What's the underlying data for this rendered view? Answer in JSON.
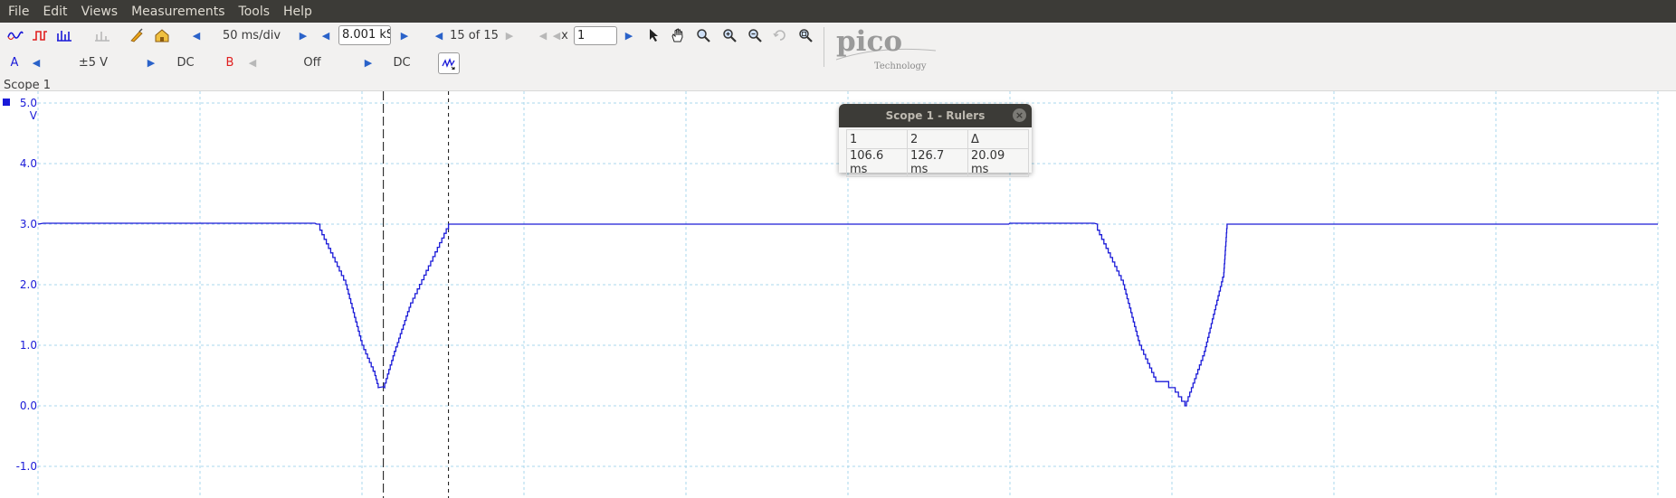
{
  "menu": [
    "File",
    "Edit",
    "Views",
    "Measurements",
    "Tools",
    "Help"
  ],
  "toolbar": {
    "timebase": "50 ms/div",
    "samples": "8.001 kS",
    "buffer": "15 of 15",
    "zoom_label": "x",
    "zoom_value": "1",
    "tool_icons": [
      "pointer-icon",
      "hand-icon",
      "zoom-area-icon",
      "zoom-in-icon",
      "zoom-out-icon",
      "undo-zoom-icon",
      "zoom-fit-icon"
    ]
  },
  "channels": {
    "a": {
      "name": "A",
      "range": "±5 V",
      "coupling": "DC",
      "color": "#1a1ad8"
    },
    "b": {
      "name": "B",
      "range": "Off",
      "coupling": "DC",
      "color": "#e02020"
    }
  },
  "logo": {
    "brand": "pico",
    "sub": "Technology"
  },
  "scope": {
    "title": "Scope 1",
    "y_unit": "V",
    "y_ticks": [
      "5.0",
      "4.0",
      "3.0",
      "2.0",
      "1.0",
      "0.0",
      "-1.0"
    ]
  },
  "rulers": {
    "title": "Scope 1 - Rulers",
    "headers": [
      "1",
      "2",
      "Δ"
    ],
    "values": [
      "106.6 ms",
      "126.7 ms",
      "20.09 ms"
    ]
  },
  "chart_data": {
    "type": "line",
    "xlabel": "",
    "ylabel": "V",
    "ylim": [
      -1.4,
      5.0
    ],
    "x_unit": "ms",
    "xlim": [
      0,
      500
    ],
    "grid": true,
    "series": [
      {
        "color": "#1a1ad8",
        "x": [
          0,
          86,
          87,
          95,
          100,
          104,
          105,
          106.6,
          110,
          115,
          126.7,
          127,
          300,
          326,
          327,
          335,
          340,
          345,
          349,
          350,
          354,
          360,
          366,
          367,
          500
        ],
        "y": [
          3.0,
          3.0,
          2.9,
          2.0,
          1.0,
          0.5,
          0.3,
          0.3,
          0.9,
          1.7,
          3.0,
          3.0,
          3.0,
          3.0,
          2.9,
          2.0,
          1.0,
          0.4,
          0.3,
          0.3,
          0.0,
          0.9,
          2.2,
          3.0,
          3.0
        ]
      }
    ],
    "rulers_x": [
      106.6,
      126.7
    ]
  }
}
